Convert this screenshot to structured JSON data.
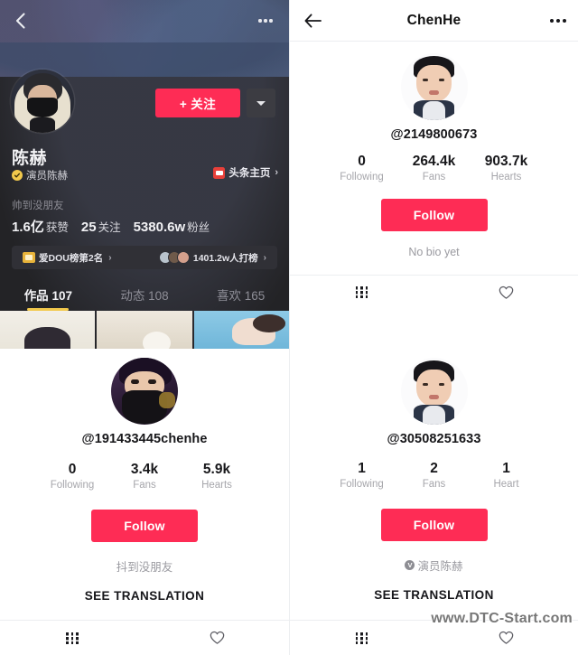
{
  "douyin_panel": {
    "back_icon": "chevron-left-icon",
    "more_icon": "more-horizontal-icon",
    "avatar_alt": "masked-man-hoodie-avatar",
    "follow_label": "+ 关注",
    "dropdown_icon": "caret-down-icon",
    "display_name": "陈赫",
    "verified_badge_icon": "verified-check-icon",
    "verified_text": "演员陈赫",
    "toutiao_label": "头条主页",
    "toutiao_icon": "toutiao-app-icon",
    "chevron": "›",
    "bio": "帅到没朋友",
    "stats": [
      {
        "value": "1.6亿",
        "label": "获赞"
      },
      {
        "value": "25",
        "label": "关注"
      },
      {
        "value": "5380.6w",
        "label": "粉丝"
      }
    ],
    "ranks": [
      {
        "icon": "crown-icon",
        "label": "爱DOU榜第2名",
        "chevron": "›"
      },
      {
        "icon": "fan-avatars-icon",
        "label": "1401.2w人打榜",
        "chevron": "›"
      }
    ],
    "tabs": [
      {
        "label": "作品 107",
        "active": true
      },
      {
        "label": "动态 108",
        "active": false
      },
      {
        "label": "喜欢 165",
        "active": false
      }
    ],
    "thumbnails": [
      "video-thumb-1",
      "video-thumb-2",
      "video-thumb-3"
    ]
  },
  "tiktok_top_right": {
    "header": {
      "back_icon": "arrow-left-icon",
      "title": "ChenHe",
      "more_icon": "more-horizontal-icon"
    },
    "avatar_alt": "chenhe-portrait-avatar",
    "handle": "@2149800673",
    "stats": [
      {
        "value": "0",
        "label": "Following"
      },
      {
        "value": "264.4k",
        "label": "Fans"
      },
      {
        "value": "903.7k",
        "label": "Hearts"
      }
    ],
    "follow_label": "Follow",
    "bio": "No bio yet",
    "tabs": [
      {
        "icon": "grid-posts-icon"
      },
      {
        "icon": "heart-liked-icon"
      }
    ]
  },
  "tiktok_bottom_left": {
    "avatar_alt": "masked-man-purple-avatar",
    "handle": "@191433445chenhe",
    "stats": [
      {
        "value": "0",
        "label": "Following"
      },
      {
        "value": "3.4k",
        "label": "Fans"
      },
      {
        "value": "5.9k",
        "label": "Hearts"
      }
    ],
    "follow_label": "Follow",
    "bio": "抖到没朋友",
    "translate_label": "SEE TRANSLATION",
    "tabs": [
      {
        "icon": "grid-posts-icon"
      },
      {
        "icon": "heart-liked-icon"
      }
    ]
  },
  "tiktok_bottom_right": {
    "avatar_alt": "chenhe-portrait-avatar",
    "handle": "@30508251633",
    "stats": [
      {
        "value": "1",
        "label": "Following"
      },
      {
        "value": "2",
        "label": "Fans"
      },
      {
        "value": "1",
        "label": "Heart"
      }
    ],
    "follow_label": "Follow",
    "verified_mark": "V",
    "bio": "演员陈赫",
    "translate_label": "SEE TRANSLATION",
    "tabs": [
      {
        "icon": "grid-posts-icon"
      },
      {
        "icon": "heart-liked-icon"
      }
    ]
  },
  "watermark": "www.DTC-Start.com",
  "colors": {
    "brand_red": "#fe2c55",
    "douyin_bg": "#232326",
    "douyin_panel": "#303036",
    "tab_underline": "#f2c94c",
    "muted_text": "#a6a6ab",
    "verified_yellow": "#f2c94c"
  }
}
